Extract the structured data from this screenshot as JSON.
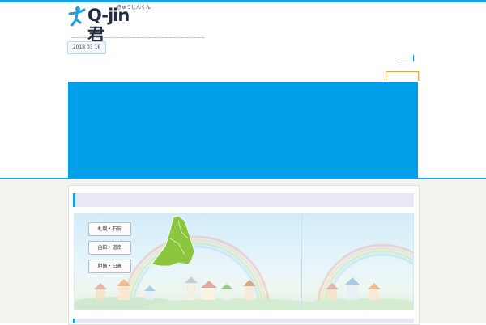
{
  "header": {
    "logo_text": "Q-jin君",
    "logo_ruby": "きゅうじんくん",
    "tagline": "ーーーーーーーーーーーーーーーーーーーーーーーーーーーーーーーーー",
    "date": "2018 03 16"
  },
  "colors": {
    "brand": "#1a9fe3",
    "hero": "#009fe8",
    "map_green": "#8cc63f",
    "accent": "#f2a33a"
  },
  "map": {
    "area_buttons": [
      "札幌・石狩",
      "函館・道南",
      "胆振・日高"
    ]
  }
}
